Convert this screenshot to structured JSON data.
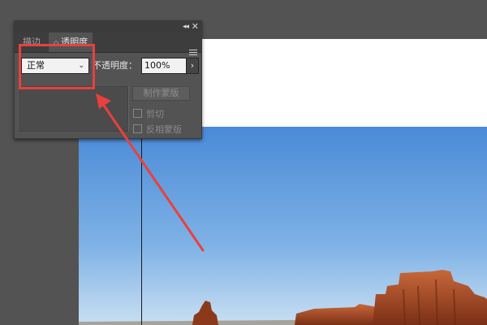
{
  "panel": {
    "collapse_icon": "double-chevron-left",
    "close_icon": "close-x",
    "tabs": [
      {
        "label": "描边",
        "active": false
      },
      {
        "label": "透明度",
        "active": true
      }
    ],
    "menu_icon": "hamburger",
    "blend_mode": {
      "value": "正常"
    },
    "opacity": {
      "label": "不透明度：",
      "value": "100%",
      "arrow": "›"
    },
    "mask_button": "制作蒙版",
    "checkboxes": [
      {
        "label": "剪切",
        "checked": false
      },
      {
        "label": "反相蒙版",
        "checked": false
      }
    ]
  },
  "colors": {
    "workspace": "#535353",
    "annotation": "#e8413d",
    "sky_top": "#4a8ad7",
    "rock": "#b8552b"
  },
  "annotation": {
    "shape": "rectangle-with-arrow",
    "target": "blend-mode-select"
  }
}
